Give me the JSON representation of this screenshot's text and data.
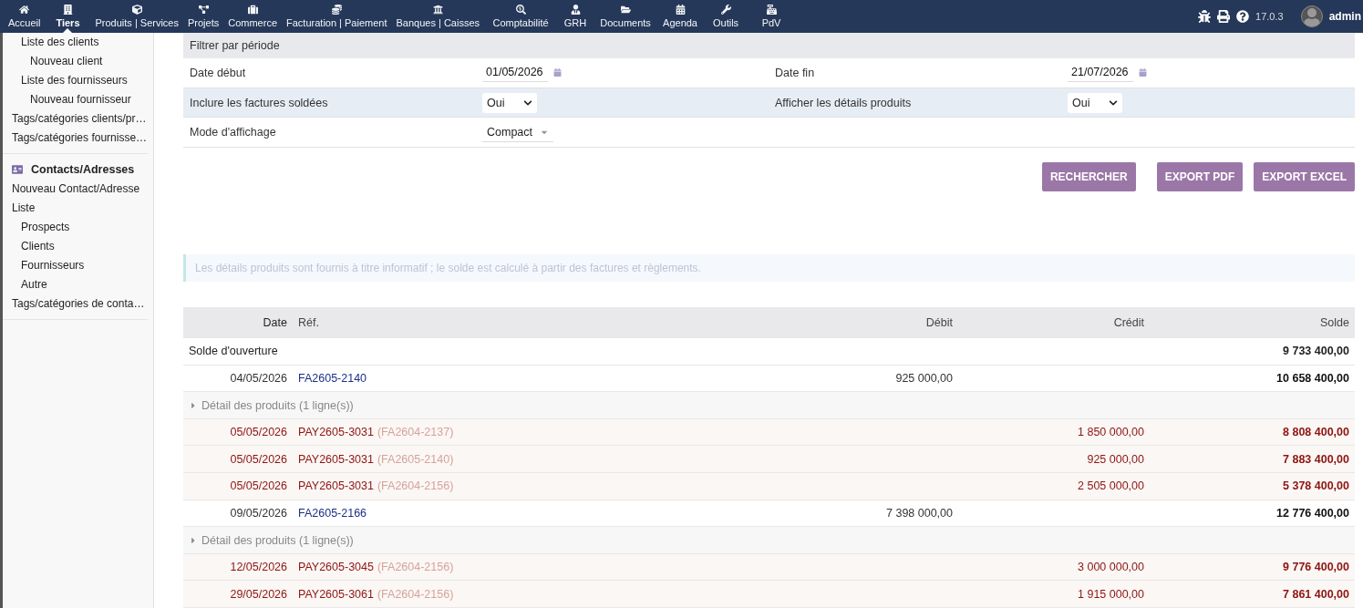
{
  "topbar": {
    "menu": [
      {
        "label": "Accueil",
        "selected": false
      },
      {
        "label": "Tiers",
        "selected": true
      },
      {
        "label": "Produits | Services",
        "selected": false
      },
      {
        "label": "Projets",
        "selected": false
      },
      {
        "label": "Commerce",
        "selected": false
      },
      {
        "label": "Facturation | Paiement",
        "selected": false
      },
      {
        "label": "Banques | Caisses",
        "selected": false
      },
      {
        "label": "Comptabilité",
        "selected": false
      },
      {
        "label": "GRH",
        "selected": false
      },
      {
        "label": "Documents",
        "selected": false
      },
      {
        "label": "Agenda",
        "selected": false
      },
      {
        "label": "Outils",
        "selected": false
      },
      {
        "label": "PdV",
        "selected": false
      }
    ],
    "version": "17.0.3",
    "user": "admin"
  },
  "sidebar": {
    "sections": [
      {
        "continued_items": [
          {
            "label": "Liste des clients",
            "children": [
              {
                "label": "Nouveau client"
              }
            ]
          },
          {
            "label": "Liste des fournisseurs",
            "children": [
              {
                "label": "Nouveau fournisseur"
              }
            ]
          }
        ],
        "items": [
          {
            "label": "Tags/catégories clients/pr…"
          },
          {
            "label": "Tags/catégories fournisse…"
          }
        ]
      },
      {
        "heading": "Contacts/Adresses",
        "items": [
          {
            "label": "Nouveau Contact/Adresse"
          },
          {
            "label": "Liste",
            "children": [
              {
                "label": "Prospects"
              },
              {
                "label": "Clients"
              },
              {
                "label": "Fournisseurs"
              },
              {
                "label": "Autre"
              }
            ]
          },
          {
            "label": "Tags/catégories de conta…"
          }
        ]
      }
    ]
  },
  "filter": {
    "title": "Filtrer par période",
    "rows": [
      {
        "fields": [
          {
            "label": "Date début",
            "kind": "date",
            "value": "01/05/2026"
          },
          {
            "label": "Date fin",
            "kind": "date",
            "value": "21/07/2026"
          }
        ]
      },
      {
        "fields": [
          {
            "label": "Inclure les factures soldées",
            "kind": "select",
            "value": "Oui"
          },
          {
            "label": "Afficher les détails produits",
            "kind": "select",
            "value": "Oui"
          }
        ]
      },
      {
        "fields": [
          {
            "label": "Mode d'affichage",
            "kind": "combo",
            "value": "Compact"
          }
        ]
      }
    ]
  },
  "buttons": [
    "RECHERCHER",
    "EXPORT PDF",
    "EXPORT EXCEL"
  ],
  "info": "Les détails produits sont fournis à titre informatif ; le solde est calculé à partir des factures et règlements.",
  "table": {
    "columns": [
      "Date",
      "Réf.",
      "Débit",
      "Crédit",
      "Solde"
    ],
    "rows": [
      {
        "kind": "opening",
        "label": "Solde d'ouverture",
        "balance": "9 733 400,00"
      },
      {
        "kind": "invoice",
        "date": "04/05/2026",
        "ref": "FA2605-2140",
        "debit": "925 000,00",
        "balance": "10 658 400,00"
      },
      {
        "kind": "detail",
        "label": "Détail des produits (1 ligne(s))",
        "expanded": false
      },
      {
        "kind": "payment",
        "date": "05/05/2026",
        "ref": "PAY2605-3031",
        "linked": "(FA2604-2137)",
        "credit": "1 850 000,00",
        "balance": "8 808 400,00"
      },
      {
        "kind": "payment",
        "date": "05/05/2026",
        "ref": "PAY2605-3031",
        "linked": "(FA2605-2140)",
        "credit": "925 000,00",
        "balance": "7 883 400,00"
      },
      {
        "kind": "payment",
        "date": "05/05/2026",
        "ref": "PAY2605-3031",
        "linked": "(FA2604-2156)",
        "credit": "2 505 000,00",
        "balance": "5 378 400,00"
      },
      {
        "kind": "invoice",
        "date": "09/05/2026",
        "ref": "FA2605-2166",
        "debit": "7 398 000,00",
        "balance": "12 776 400,00"
      },
      {
        "kind": "detail",
        "label": "Détail des produits (1 ligne(s))",
        "expanded": false
      },
      {
        "kind": "payment",
        "date": "12/05/2026",
        "ref": "PAY2605-3045",
        "linked": "(FA2604-2156)",
        "credit": "3 000 000,00",
        "balance": "9 776 400,00"
      },
      {
        "kind": "payment",
        "date": "29/05/2026",
        "ref": "PAY2605-3061",
        "linked": "(FA2604-2156)",
        "credit": "1 915 000,00",
        "balance": "7 861 400,00"
      }
    ]
  }
}
